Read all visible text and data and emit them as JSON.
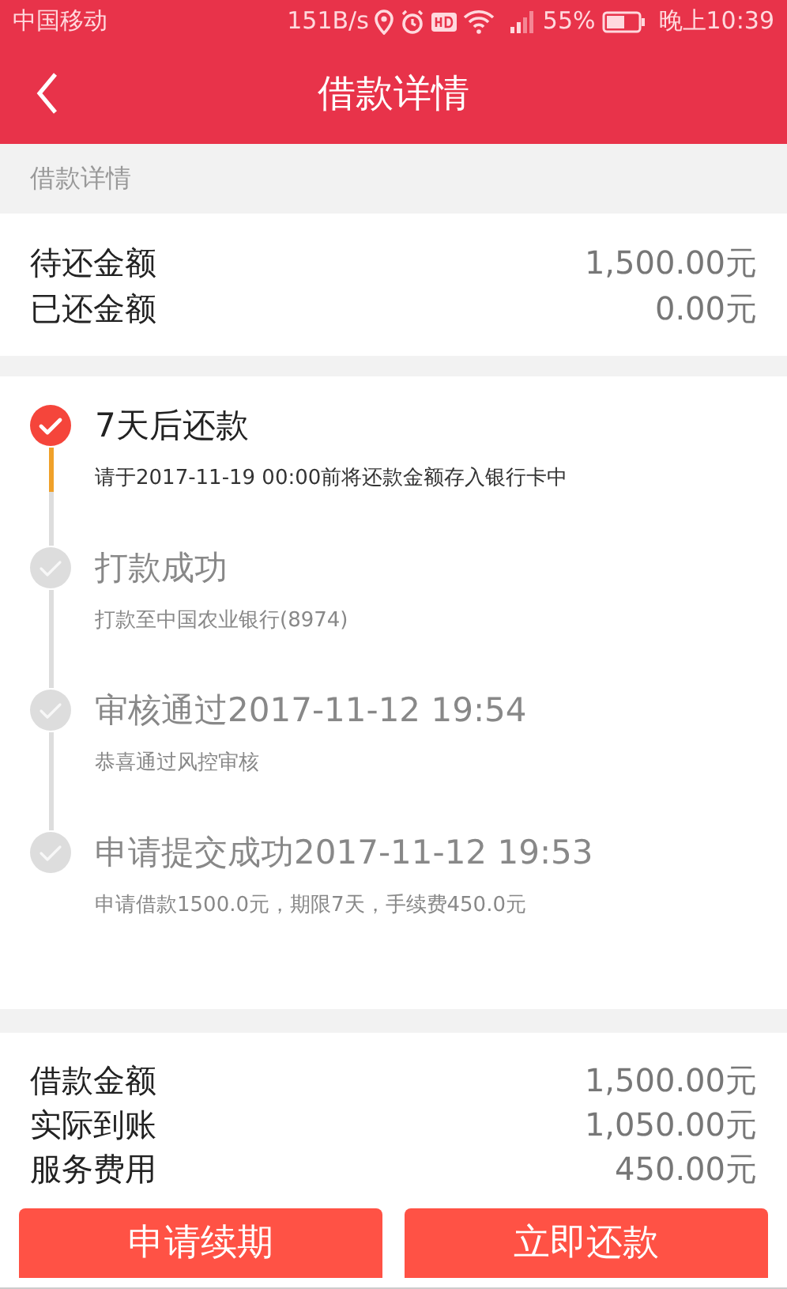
{
  "status_bar": {
    "carrier": "中国移动",
    "speed": "151B/s",
    "battery": "55%",
    "time": "晚上10:39"
  },
  "header": {
    "title": "借款详情"
  },
  "section_label": "借款详情",
  "summary": [
    {
      "label": "待还金额",
      "value": "1,500.00元"
    },
    {
      "label": "已还金额",
      "value": "0.00元"
    }
  ],
  "timeline": [
    {
      "title": "7天后还款",
      "detail": "请于2017-11-19 00:00前将还款金额存入银行卡中",
      "current": true
    },
    {
      "title": "打款成功",
      "detail": "打款至中国农业银行(8974)",
      "current": false
    },
    {
      "title": "审核通过2017-11-12 19:54",
      "detail": "恭喜通过风控审核",
      "current": false
    },
    {
      "title": "申请提交成功2017-11-12 19:53",
      "detail": "申请借款1500.0元，期限7天，手续费450.0元",
      "current": false
    }
  ],
  "loan": [
    {
      "label": "借款金额",
      "value": "1,500.00元"
    },
    {
      "label": "实际到账",
      "value": "1,050.00元"
    },
    {
      "label": "服务费用",
      "value": "450.00元"
    }
  ],
  "buttons": [
    "申请续期",
    "立即还款"
  ]
}
